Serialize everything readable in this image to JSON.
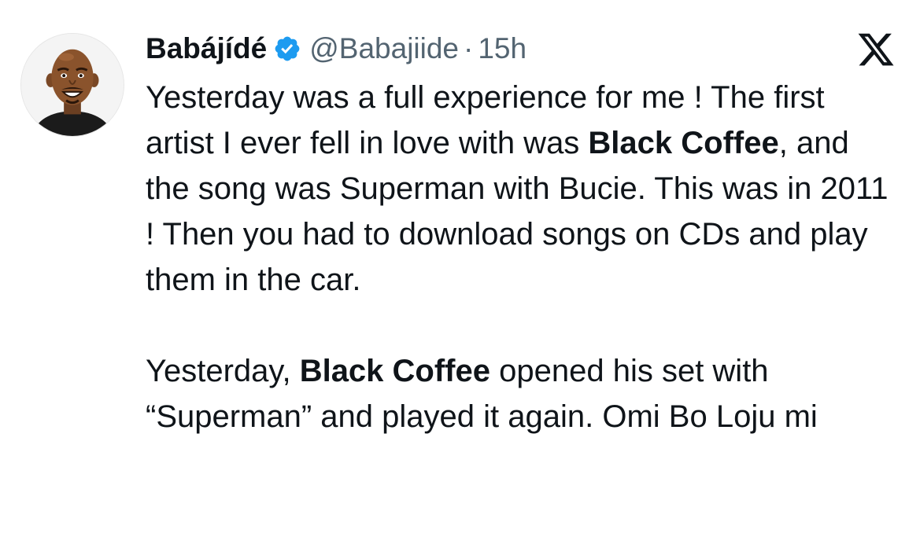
{
  "tweet": {
    "author": {
      "name": "Babájídé",
      "handle": "@Babajiide",
      "time": "15h",
      "separator": "·",
      "verified": true,
      "avatar_icon": "cartoon-man-avatar"
    },
    "close_icon": "x-logo-icon",
    "paragraph1": {
      "part1": "Yesterday was a full experience for me ! The first artist I ever fell in love with was ",
      "bold1": "Black Coffee",
      "part2": ", and the song was Superman with Bucie. This was in 2011 ! Then you had to download songs on CDs and play them in the car."
    },
    "paragraph2": {
      "part1": "Yesterday, ",
      "bold1": "Black Coffee",
      "part2": " opened his set with “Superman” and played it again. Omi Bo Loju mi"
    }
  },
  "colors": {
    "text": "#0f1419",
    "secondary": "#536471",
    "verified": "#1d9bf0",
    "background": "#ffffff"
  }
}
